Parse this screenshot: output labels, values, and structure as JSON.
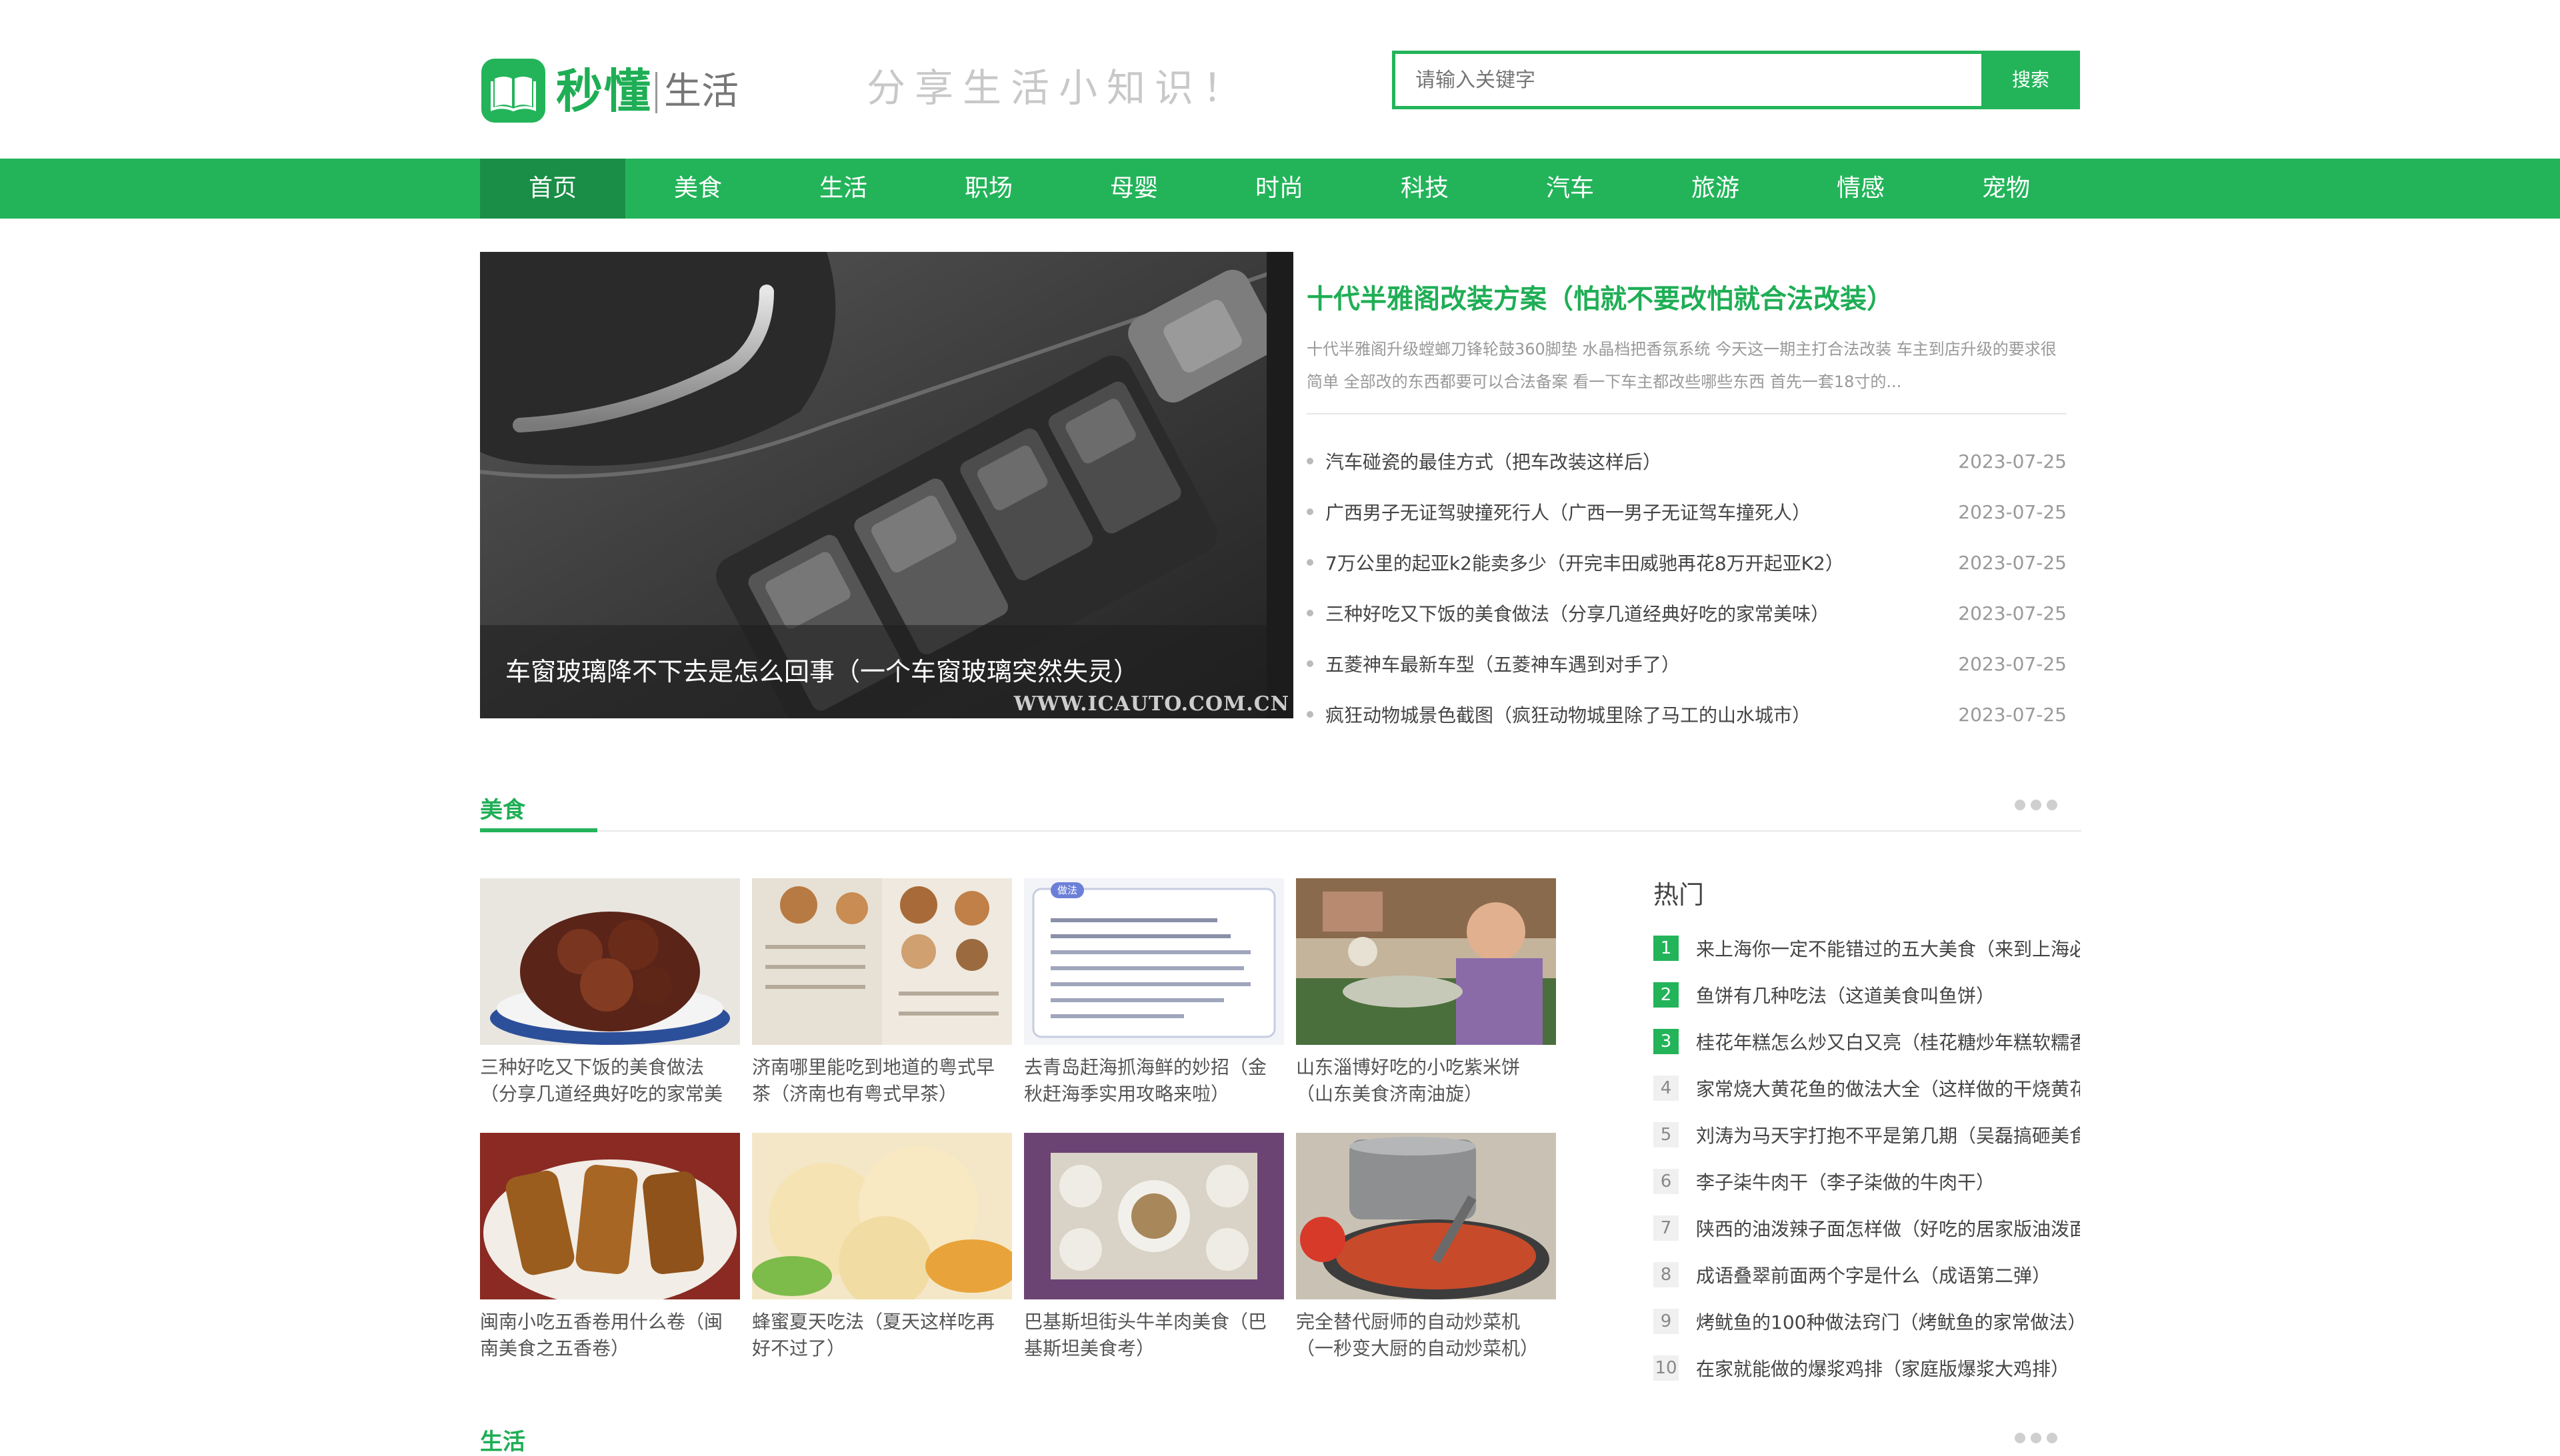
{
  "header": {
    "logo_main": "秒懂",
    "logo_sub": "生活",
    "slogan": "分享生活小知识！",
    "search_placeholder": "请输入关键字",
    "search_button": "搜索",
    "accent_color": "#23b45a"
  },
  "nav": {
    "items": [
      "首页",
      "美食",
      "生活",
      "职场",
      "母婴",
      "时尚",
      "科技",
      "汽车",
      "旅游",
      "情感",
      "宠物"
    ],
    "active_index": 0
  },
  "feature": {
    "image_caption": "车窗玻璃降不下去是怎么回事（一个车窗玻璃突然失灵）",
    "watermark": "WWW.ICAUTO.COM.CN",
    "headline": "十代半雅阁改装方案（怕就不要改怕就合法改装）",
    "summary": "十代半雅阁升级螳螂刀锋轮鼓360脚垫 水晶档把香氛系统 今天这一期主打合法改装 车主到店升级的要求很简单 全部改的东西都要可以合法备案 看一下车主都改些哪些东西 首先一套18寸的...",
    "news": [
      {
        "title": "汽车碰瓷的最佳方式（把车改装这样后）",
        "date": "2023-07-25"
      },
      {
        "title": "广西男子无证驾驶撞死行人（广西一男子无证驾车撞死人）",
        "date": "2023-07-25"
      },
      {
        "title": "7万公里的起亚k2能卖多少（开完丰田威驰再花8万开起亚K2）",
        "date": "2023-07-25"
      },
      {
        "title": "三种好吃又下饭的美食做法（分享几道经典好吃的家常美味）",
        "date": "2023-07-25"
      },
      {
        "title": "五菱神车最新车型（五菱神车遇到对手了）",
        "date": "2023-07-25"
      },
      {
        "title": "疯狂动物城景色截图（疯狂动物城里除了马工的山水城市）",
        "date": "2023-07-25"
      }
    ]
  },
  "food_section": {
    "title": "美食",
    "cards": [
      {
        "caption": "三种好吃又下饭的美食做法（分享几道经典好吃的家常美味）",
        "image": "braised-pork-photo"
      },
      {
        "caption": "济南哪里能吃到地道的粤式早茶（济南也有粤式早茶）",
        "image": "dim-sum-menu-photo"
      },
      {
        "caption": "去青岛赶海抓海鲜的妙招（金秋赶海季实用攻略来啦）",
        "image": "recipe-card-photo",
        "badge": "做法"
      },
      {
        "caption": "山东淄博好吃的小吃紫米饼（山东美食济南油旋）",
        "image": "diner-photo"
      },
      {
        "caption": "闽南小吃五香卷用什么卷（闽南美食之五香卷）",
        "image": "five-spice-rolls-photo"
      },
      {
        "caption": "蜂蜜夏天吃法（夏天这样吃再好不过了）",
        "image": "ice-cream-photo"
      },
      {
        "caption": "巴基斯坦街头牛羊肉美食（巴基斯坦美食考）",
        "image": "table-setting-photo"
      },
      {
        "caption": "完全替代厨师的自动炒菜机（一秒变大厨的自动炒菜机）",
        "image": "cooking-pot-photo"
      }
    ]
  },
  "hot": {
    "title": "热门",
    "items": [
      "来上海你一定不能错过的五大美食（来到上海必吃的美食）",
      "鱼饼有几种吃法（这道美食叫鱼饼）",
      "桂花年糕怎么炒又白又亮（桂花糖炒年糕软糯香甜）",
      "家常烧大黄花鱼的做法大全（这样做的干烧黄花鱼）",
      "刘涛为马天宇打抱不平是第几期（吴磊搞砸美食）",
      "李子柒牛肉干（李子柒做的牛肉干）",
      "陕西的油泼辣子面怎样做（好吃的居家版油泼面）",
      "成语叠翠前面两个字是什么（成语第二弹）",
      "烤鱿鱼的100种做法窍门（烤鱿鱼的家常做法）",
      "在家就能做的爆浆鸡排（家庭版爆浆大鸡排）"
    ]
  },
  "next_section": {
    "title": "生活"
  }
}
